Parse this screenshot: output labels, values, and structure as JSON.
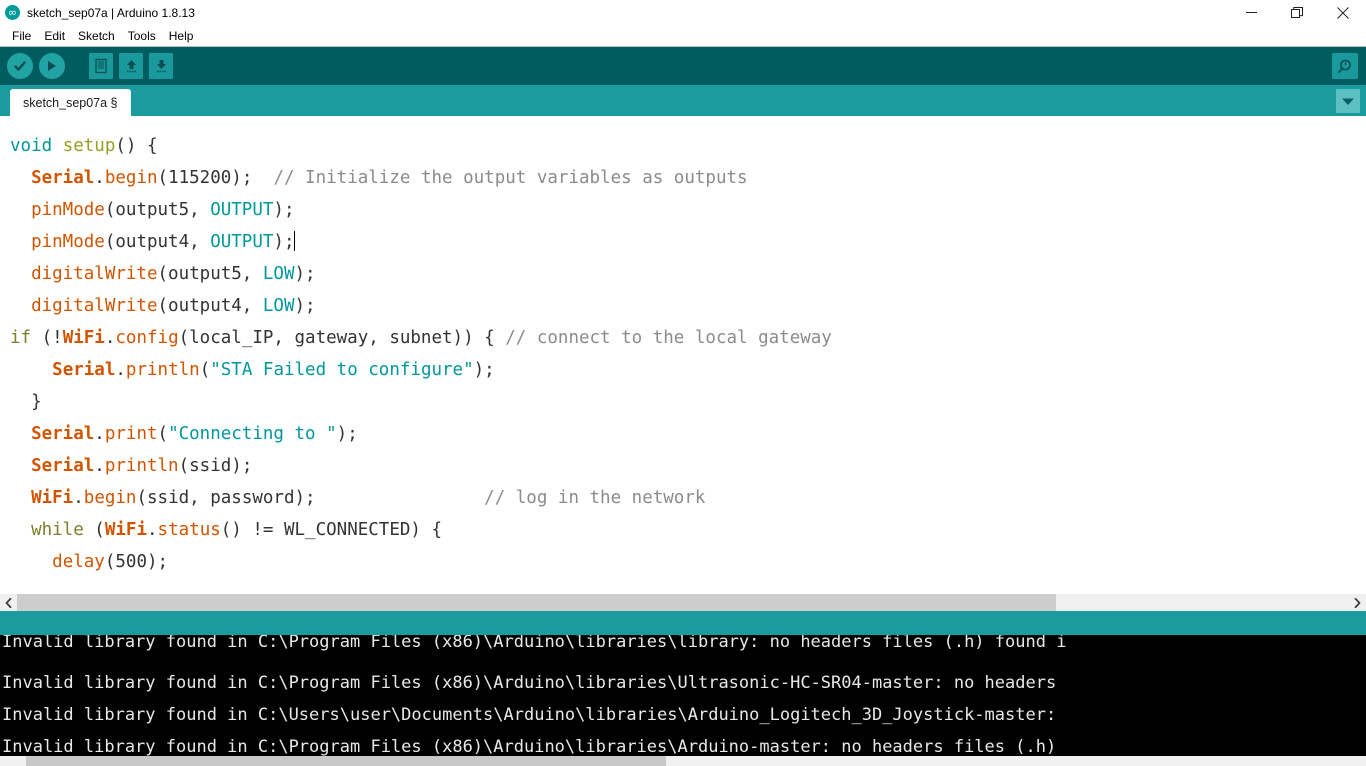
{
  "window": {
    "title": "sketch_sep07a | Arduino 1.8.13",
    "logo_icon": "arduino-infinity-logo",
    "controls": {
      "minimize": "minimize-icon",
      "restore": "restore-icon",
      "close": "close-icon"
    }
  },
  "menubar": {
    "items": [
      {
        "label": "File"
      },
      {
        "label": "Edit"
      },
      {
        "label": "Sketch"
      },
      {
        "label": "Tools"
      },
      {
        "label": "Help"
      }
    ]
  },
  "toolbar": {
    "verify_icon": "checkmark-icon",
    "upload_icon": "arrow-right-icon",
    "new_icon": "new-document-icon",
    "open_icon": "arrow-up-icon",
    "save_icon": "arrow-down-icon",
    "serial_monitor_icon": "magnifier-icon"
  },
  "tabbar": {
    "tabs": [
      {
        "label": "sketch_sep07a §"
      }
    ],
    "dropdown_icon": "chevron-down-icon"
  },
  "editor": {
    "lines": [
      {
        "indent": 0,
        "tokens": [
          {
            "t": "void",
            "c": "t-key"
          },
          {
            "t": " ",
            "c": "t-plain"
          },
          {
            "t": "setup",
            "c": "t-fnname"
          },
          {
            "t": "() {",
            "c": "t-plain"
          }
        ]
      },
      {
        "indent": 2,
        "tokens": [
          {
            "t": "Serial",
            "c": "t-objbold"
          },
          {
            "t": ".",
            "c": "t-plain"
          },
          {
            "t": "begin",
            "c": "t-method"
          },
          {
            "t": "(115200);  ",
            "c": "t-plain"
          },
          {
            "t": "// Initialize the output variables as outputs",
            "c": "t-comment"
          }
        ]
      },
      {
        "indent": 2,
        "tokens": [
          {
            "t": "pinMode",
            "c": "t-method"
          },
          {
            "t": "(output5, ",
            "c": "t-plain"
          },
          {
            "t": "OUTPUT",
            "c": "t-const"
          },
          {
            "t": ");",
            "c": "t-plain"
          }
        ]
      },
      {
        "indent": 2,
        "caret": true,
        "tokens": [
          {
            "t": "pinMode",
            "c": "t-method"
          },
          {
            "t": "(output4, ",
            "c": "t-plain"
          },
          {
            "t": "OUTPUT",
            "c": "t-const"
          },
          {
            "t": ");",
            "c": "t-plain"
          }
        ]
      },
      {
        "indent": 2,
        "tokens": [
          {
            "t": "digitalWrite",
            "c": "t-method"
          },
          {
            "t": "(output5, ",
            "c": "t-plain"
          },
          {
            "t": "LOW",
            "c": "t-const"
          },
          {
            "t": ");",
            "c": "t-plain"
          }
        ]
      },
      {
        "indent": 2,
        "tokens": [
          {
            "t": "digitalWrite",
            "c": "t-method"
          },
          {
            "t": "(output4, ",
            "c": "t-plain"
          },
          {
            "t": "LOW",
            "c": "t-const"
          },
          {
            "t": ");",
            "c": "t-plain"
          }
        ]
      },
      {
        "indent": 0,
        "tokens": [
          {
            "t": "if",
            "c": "t-ctrl"
          },
          {
            "t": " (!",
            "c": "t-plain"
          },
          {
            "t": "WiFi",
            "c": "t-objbold"
          },
          {
            "t": ".",
            "c": "t-plain"
          },
          {
            "t": "config",
            "c": "t-method"
          },
          {
            "t": "(local_IP, gateway, subnet)) { ",
            "c": "t-plain"
          },
          {
            "t": "// connect to the local gateway",
            "c": "t-comment"
          }
        ]
      },
      {
        "indent": 4,
        "tokens": [
          {
            "t": "Serial",
            "c": "t-objbold"
          },
          {
            "t": ".",
            "c": "t-plain"
          },
          {
            "t": "println",
            "c": "t-method"
          },
          {
            "t": "(",
            "c": "t-plain"
          },
          {
            "t": "\"STA Failed to configure\"",
            "c": "t-string"
          },
          {
            "t": ");",
            "c": "t-plain"
          }
        ]
      },
      {
        "indent": 2,
        "tokens": [
          {
            "t": "}",
            "c": "t-plain"
          }
        ]
      },
      {
        "indent": 2,
        "tokens": [
          {
            "t": "Serial",
            "c": "t-objbold"
          },
          {
            "t": ".",
            "c": "t-plain"
          },
          {
            "t": "print",
            "c": "t-method"
          },
          {
            "t": "(",
            "c": "t-plain"
          },
          {
            "t": "\"Connecting to \"",
            "c": "t-string"
          },
          {
            "t": ");",
            "c": "t-plain"
          }
        ]
      },
      {
        "indent": 2,
        "tokens": [
          {
            "t": "Serial",
            "c": "t-objbold"
          },
          {
            "t": ".",
            "c": "t-plain"
          },
          {
            "t": "println",
            "c": "t-method"
          },
          {
            "t": "(ssid);",
            "c": "t-plain"
          }
        ]
      },
      {
        "indent": 2,
        "tokens": [
          {
            "t": "WiFi",
            "c": "t-objbold"
          },
          {
            "t": ".",
            "c": "t-plain"
          },
          {
            "t": "begin",
            "c": "t-method"
          },
          {
            "t": "(ssid, password);                ",
            "c": "t-plain"
          },
          {
            "t": "// log in the network",
            "c": "t-comment"
          }
        ]
      },
      {
        "indent": 2,
        "tokens": [
          {
            "t": "while",
            "c": "t-ctrl"
          },
          {
            "t": " (",
            "c": "t-plain"
          },
          {
            "t": "WiFi",
            "c": "t-objbold"
          },
          {
            "t": ".",
            "c": "t-plain"
          },
          {
            "t": "status",
            "c": "t-method"
          },
          {
            "t": "() != WL_CONNECTED) {",
            "c": "t-plain"
          }
        ]
      },
      {
        "indent": 4,
        "tokens": [
          {
            "t": "delay",
            "c": "t-method"
          },
          {
            "t": "(500);",
            "c": "t-plain"
          }
        ]
      }
    ],
    "hscroll": {
      "left_arrow_icon": "chevron-left-icon",
      "right_arrow_icon": "chevron-right-icon"
    }
  },
  "console": {
    "lines": [
      "Invalid library found in C:\\Program Files (x86)\\Arduino\\libraries\\library: no headers files (.h) found i",
      "Invalid library found in C:\\Program Files (x86)\\Arduino\\libraries\\Ultrasonic-HC-SR04-master: no headers",
      "Invalid library found in C:\\Users\\user\\Documents\\Arduino\\libraries\\Arduino_Logitech_3D_Joystick-master:",
      "Invalid library found in C:\\Program Files (x86)\\Arduino\\libraries\\Arduino-master: no headers files (.h)"
    ]
  },
  "colors": {
    "toolbar_bg": "#005c5f",
    "tabbar_bg": "#1a9b9e",
    "accent": "#00979c",
    "console_bg": "#000000",
    "keyword": "#00979c",
    "method": "#d35400",
    "comment": "#8b8b8b"
  }
}
